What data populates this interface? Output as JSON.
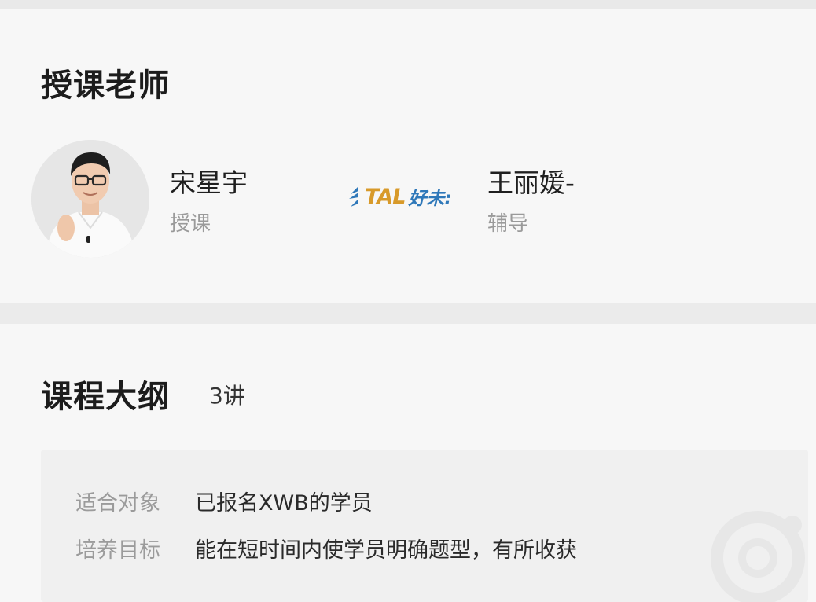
{
  "teachers_section": {
    "title": "授课老师",
    "teachers": [
      {
        "name": "宋星宇",
        "role": "授课"
      },
      {
        "name": "王丽媛-",
        "role": "辅导"
      }
    ],
    "logo": {
      "brand_text": "TAL",
      "cn_text": "好未:"
    }
  },
  "outline_section": {
    "title": "课程大纲",
    "lesson_count": "3讲",
    "info": [
      {
        "label": "适合对象",
        "value": "已报名XWB的学员"
      },
      {
        "label": "培养目标",
        "value": "能在短时间内使学员明确题型，有所收获"
      }
    ]
  },
  "colors": {
    "background": "#f7f7f7",
    "divider": "#ebebeb",
    "title_text": "#1c1c1c",
    "secondary_text": "#9a9a9a",
    "logo_orange": "#d89a2a",
    "logo_blue": "#2f78b9"
  }
}
